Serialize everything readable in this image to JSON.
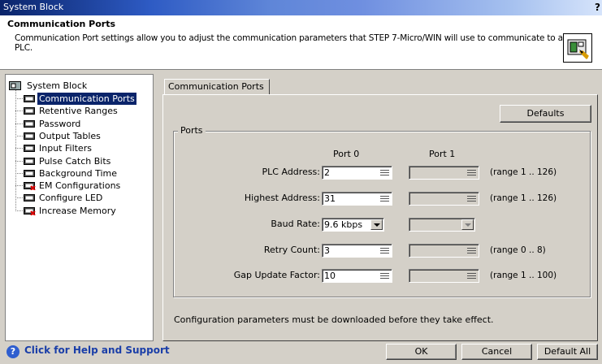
{
  "window": {
    "title": "System Block",
    "help_glyph": "?"
  },
  "header": {
    "title": "Communication Ports",
    "description": "Communication Port settings allow you to adjust the communication parameters that STEP 7-Micro/WIN will use to communicate to a given PLC."
  },
  "tree": {
    "root": "System Block",
    "items": [
      {
        "label": "Communication Ports",
        "selected": true,
        "icon": "module-icon"
      },
      {
        "label": "Retentive Ranges",
        "icon": "module-icon"
      },
      {
        "label": "Password",
        "icon": "module-icon"
      },
      {
        "label": "Output Tables",
        "icon": "module-icon"
      },
      {
        "label": "Input Filters",
        "icon": "module-icon"
      },
      {
        "label": "Pulse Catch Bits",
        "icon": "module-icon"
      },
      {
        "label": "Background Time",
        "icon": "module-icon"
      },
      {
        "label": "EM Configurations",
        "icon": "module-red-icon"
      },
      {
        "label": "Configure LED",
        "icon": "module-icon"
      },
      {
        "label": "Increase Memory",
        "icon": "module-red-icon"
      }
    ]
  },
  "help_link": "Click for Help and Support",
  "tab": {
    "label": "Communication Ports"
  },
  "defaults_button": "Defaults",
  "ports": {
    "group_title": "Ports",
    "col_port0": "Port 0",
    "col_port1": "Port 1",
    "rows": [
      {
        "label": "PLC Address:",
        "port0": "2",
        "port1": "",
        "range": "(range 1 .. 126)",
        "kind": "spin"
      },
      {
        "label": "Highest Address:",
        "port0": "31",
        "port1": "",
        "range": "(range 1 .. 126)",
        "kind": "spin"
      },
      {
        "label": "Baud Rate:",
        "port0": "9.6 kbps",
        "port1": "",
        "range": "",
        "kind": "dropdown"
      },
      {
        "label": "Retry Count:",
        "port0": "3",
        "port1": "",
        "range": "(range 0 .. 8)",
        "kind": "spin"
      },
      {
        "label": "Gap Update Factor:",
        "port0": "10",
        "port1": "",
        "range": "(range 1 .. 100)",
        "kind": "spin"
      }
    ]
  },
  "note": "Configuration parameters must be downloaded before they take effect.",
  "footer": {
    "ok": "OK",
    "cancel": "Cancel",
    "default_all": "Default All"
  }
}
